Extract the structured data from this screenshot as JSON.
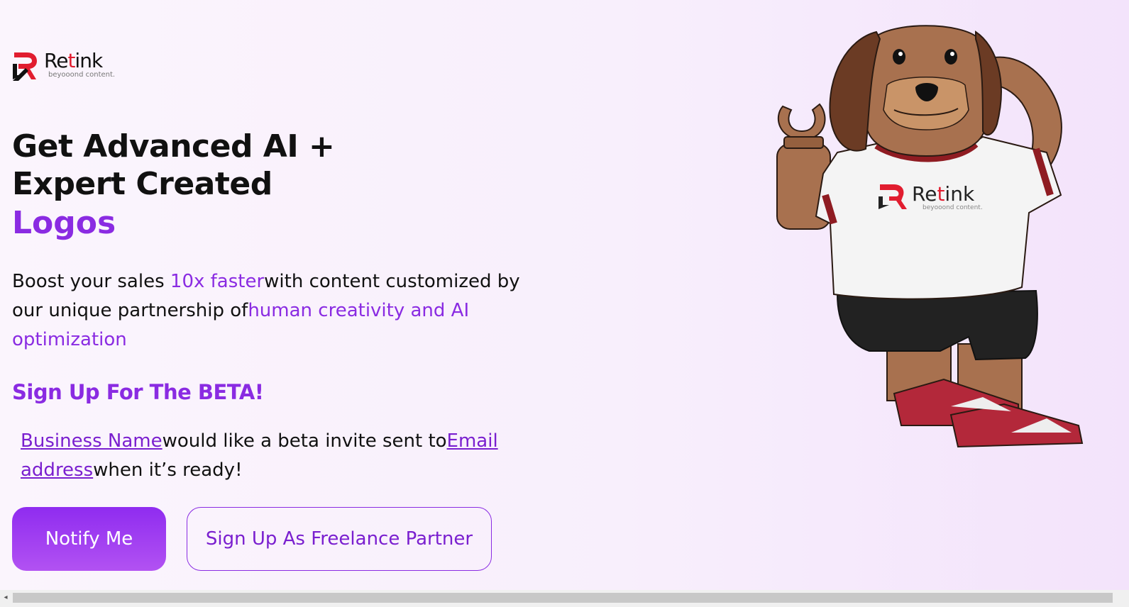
{
  "brand": {
    "name_prefix": "Re",
    "name_accent": "t",
    "name_suffix": "ink",
    "tagline": "beyooond content."
  },
  "hero": {
    "title": "Get Advanced AI + Expert Created",
    "title_accent": "Logos",
    "description": {
      "part1": "Boost your sales ",
      "highlight1": "10x faster",
      "part2": "with content customized by our unique partnership of",
      "highlight2": "human creativity and AI optimization"
    }
  },
  "beta": {
    "heading": "Sign Up For The BETA!",
    "business_name_link": "Business Name",
    "middle_text": "would like a beta invite sent to",
    "email_link": "Email address",
    "end_text": "when it’s ready!"
  },
  "buttons": {
    "notify": "Notify Me",
    "partner": "Sign Up As Freelance Partner"
  },
  "mascot_shirt": {
    "name_prefix": "Re",
    "name_accent": "t",
    "name_suffix": "ink",
    "tagline": "beyooond content."
  },
  "colors": {
    "accent_purple": "#8a2be2",
    "brand_red": "#e11d2f"
  }
}
